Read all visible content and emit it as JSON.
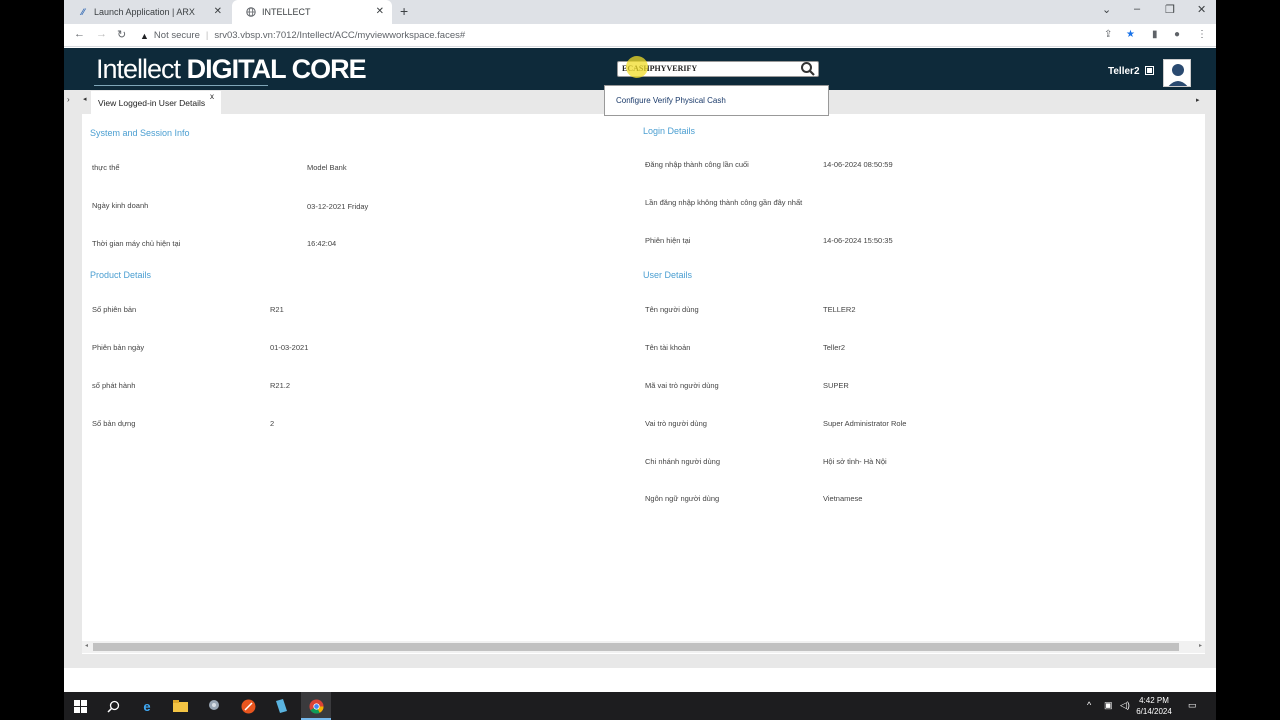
{
  "browser": {
    "tabs": [
      {
        "label": "Launch Application | ARX",
        "icon": "arx-logo-icon",
        "active": false
      },
      {
        "label": "INTELLECT",
        "icon": "globe-icon",
        "active": true
      }
    ],
    "security_label": "Not secure",
    "url": "srv03.vbsp.vn:7012/Intellect/ACC/myviewworkspace.faces#"
  },
  "header": {
    "logo_light": "Intellect",
    "logo_bold": "DIGITAL CORE",
    "search_value": "ECASHPHYVERIFY",
    "username": "Teller2",
    "background": "#0e2a3a"
  },
  "search_suggestion": "Configure Verify Physical Cash",
  "page_tab": {
    "label": "View Logged-in User Details",
    "close": "x"
  },
  "sections": {
    "system": {
      "title": "System and Session Info",
      "rows": [
        {
          "label": "thực thể",
          "value": "Model Bank"
        },
        {
          "label": "Ngày kinh doanh",
          "value": "03-12-2021 Friday"
        },
        {
          "label": "Thời gian máy chủ hiện tại",
          "value": "16:42:04"
        }
      ]
    },
    "login": {
      "title": "Login Details",
      "rows": [
        {
          "label": "Đăng nhập thành công lần cuối",
          "value": "14-06-2024 08:50:59"
        },
        {
          "label": "Lần đăng nhập không thành công gần đây nhất",
          "value": ""
        },
        {
          "label": "Phiên hiện tại",
          "value": "14-06-2024 15:50:35"
        }
      ]
    },
    "product": {
      "title": "Product Details",
      "rows": [
        {
          "label": "Số phiên bản",
          "value": "R21"
        },
        {
          "label": "Phiên bản ngày",
          "value": "01-03-2021"
        },
        {
          "label": "số phát hành",
          "value": "R21.2"
        },
        {
          "label": "Số bản dựng",
          "value": "2"
        }
      ]
    },
    "user": {
      "title": "User Details",
      "rows": [
        {
          "label": "Tên người dùng",
          "value": "TELLER2"
        },
        {
          "label": "Tên tài khoản",
          "value": "Teller2"
        },
        {
          "label": "Mã vai trò người dùng",
          "value": "SUPER"
        },
        {
          "label": "Vai trò người dùng",
          "value": "Super Administrator Role"
        },
        {
          "label": "Chi nhánh người dùng",
          "value": "Hội sở tỉnh- Hà Nội"
        },
        {
          "label": "Ngôn ngữ người dùng",
          "value": "Vietnamese"
        }
      ]
    }
  },
  "taskbar": {
    "time": "4:42 PM",
    "date": "6/14/2024"
  },
  "colors": {
    "section_title": "#4a9ed1",
    "accent_link": "#1a3a6a"
  }
}
